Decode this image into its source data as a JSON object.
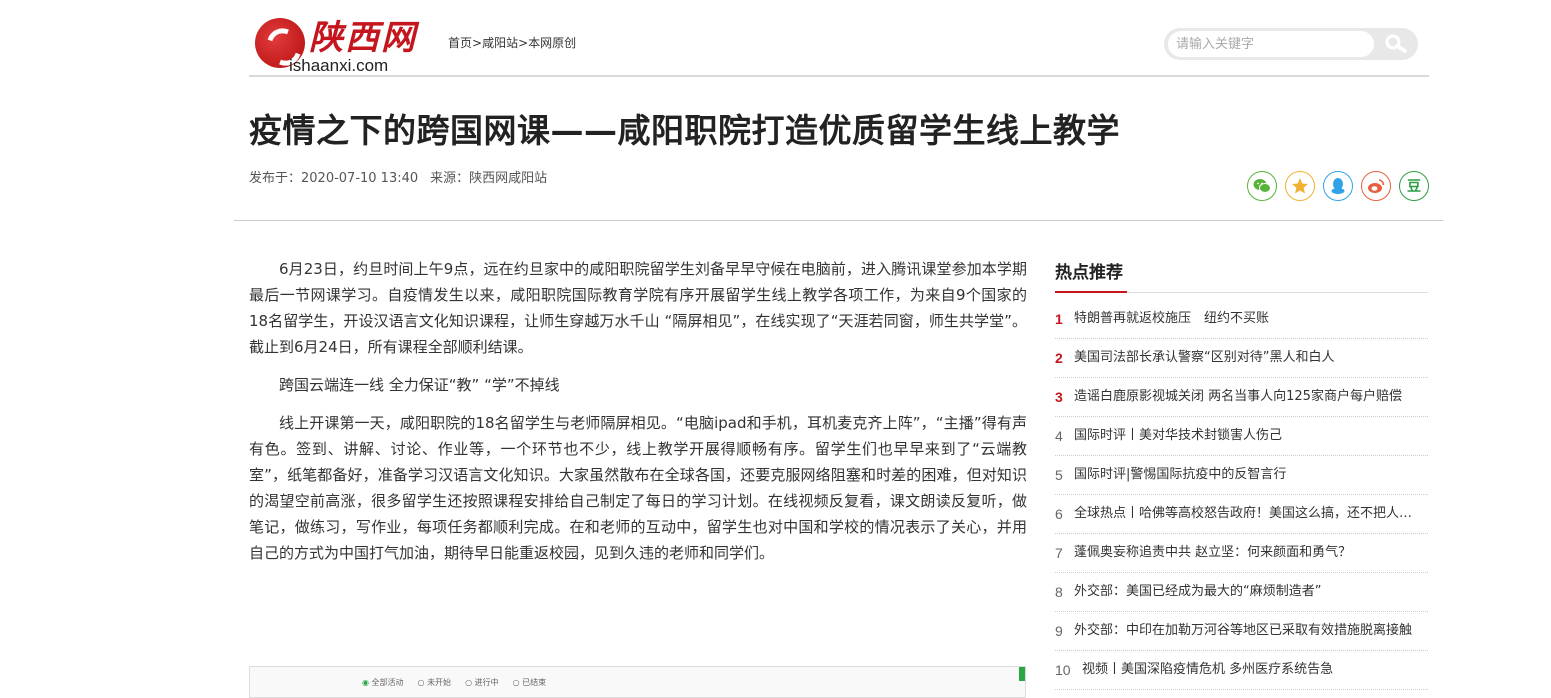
{
  "header": {
    "logo_cn": "陕西网",
    "logo_en": "ishaanxi.com",
    "breadcrumb": [
      "首页",
      "咸阳站",
      "本网原创"
    ],
    "breadcrumb_sep": ">",
    "search_placeholder": "请输入关键字"
  },
  "article": {
    "title": "疫情之下的跨国网课——咸阳职院打造优质留学生线上教学",
    "published": "发布于：2020-07-10 13:40",
    "source": "来源：陕西网咸阳站",
    "paragraphs": [
      "6月23日，约旦时间上午9点，远在约旦家中的咸阳职院留学生刘备早早守候在电脑前，进入腾讯课堂参加本学期最后一节网课学习。自疫情发生以来，咸阳职院国际教育学院有序开展留学生线上教学各项工作，为来自9个国家的18名留学生，开设汉语言文化知识课程，让师生穿越万水千山 “隔屏相见”，在线实现了“天涯若同窗，师生共学堂”。截止到6月24日，所有课程全部顺利结课。",
      "跨国云端连一线 全力保证“教” “学”不掉线",
      "线上开课第一天，咸阳职院的18名留学生与老师隔屏相见。“电脑ipad和手机，耳机麦克齐上阵”，“主播”得有声有色。签到、讲解、讨论、作业等，一个环节也不少，线上教学开展得顺畅有序。留学生们也早早来到了“云端教室”，纸笔都备好，准备学习汉语言文化知识。大家虽然散布在全球各国，还要克服网络阻塞和时差的困难，但对知识的渴望空前高涨，很多留学生还按照课程安排给自己制定了每日的学习计划。在线视频反复看，课文朗读反复听，做笔记，做练习，写作业，每项任务都顺利完成。在和老师的互动中，留学生也对中国和学校的情况表示了关心，并用自己的方式为中国打气加油，期待早日能重返校园，见到久违的老师和同学们。"
    ],
    "image_tabs": [
      "全部活动",
      "未开始",
      "进行中",
      "已结束"
    ]
  },
  "share": {
    "icons": [
      "wechat-icon",
      "qzone-icon",
      "qq-icon",
      "weibo-icon",
      "douban-icon"
    ],
    "douban_glyph": "豆"
  },
  "sidebar": {
    "title": "热点推荐",
    "items": [
      {
        "rank": "1",
        "text": "特朗普再就返校施压　纽约不买账"
      },
      {
        "rank": "2",
        "text": "美国司法部长承认警察“区别对待”黑人和白人"
      },
      {
        "rank": "3",
        "text": "造谣白鹿原影视城关闭 两名当事人向125家商户每户赔偿"
      },
      {
        "rank": "4",
        "text": "国际时评丨美对华技术封锁害人伤己"
      },
      {
        "rank": "5",
        "text": "国际时评|警惕国际抗疫中的反智言行"
      },
      {
        "rank": "6",
        "text": "全球热点丨哈佛等高校怒告政府！美国这么搞，还不把人吓跑"
      },
      {
        "rank": "7",
        "text": "蓬佩奥妄称追责中共 赵立坚：何来颜面和勇气？"
      },
      {
        "rank": "8",
        "text": "外交部：美国已经成为最大的“麻烦制造者”"
      },
      {
        "rank": "9",
        "text": "外交部：中印在加勒万河谷等地区已采取有效措施脱离接触"
      },
      {
        "rank": "10",
        "text": "视频丨美国深陷疫情危机 多州医疗系统告急"
      }
    ]
  },
  "colors": {
    "brand_red": "#c5161d",
    "accent_green": "#2aa745"
  }
}
